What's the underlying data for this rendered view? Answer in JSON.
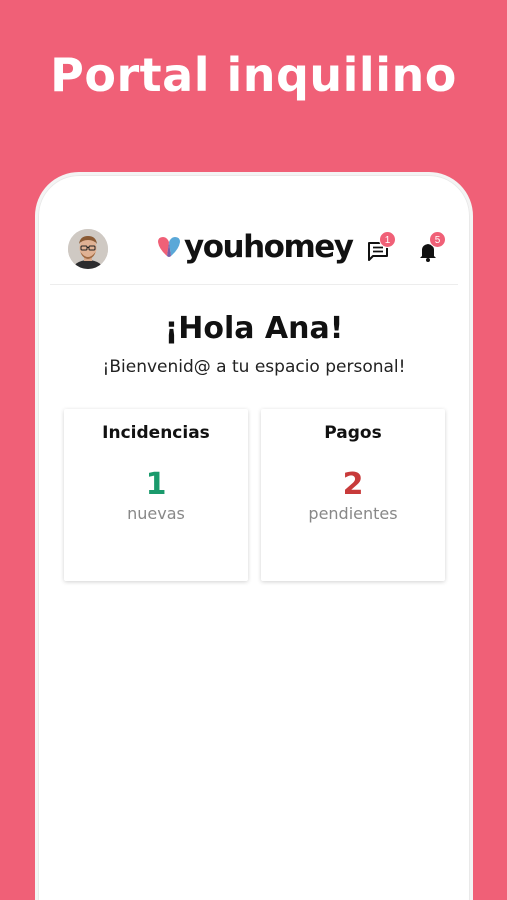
{
  "promo": {
    "title": "Portal inquilino"
  },
  "header": {
    "avatar": "user-avatar",
    "logo_text": "youhomey",
    "messages_count": "1",
    "notifications_count": "5"
  },
  "main": {
    "greeting": "¡Hola Ana!",
    "welcome": "¡Bienvenid@ a tu espacio personal!",
    "cards": [
      {
        "title": "Incidencias",
        "count": "1",
        "caption": "nuevas",
        "color": "#1a9a6c"
      },
      {
        "title": "Pagos",
        "count": "2",
        "caption": "pendientes",
        "color": "#c83a3a"
      }
    ]
  },
  "colors": {
    "brand": "#f06077",
    "card_green": "#1a9a6c",
    "card_red": "#c83a3a"
  }
}
